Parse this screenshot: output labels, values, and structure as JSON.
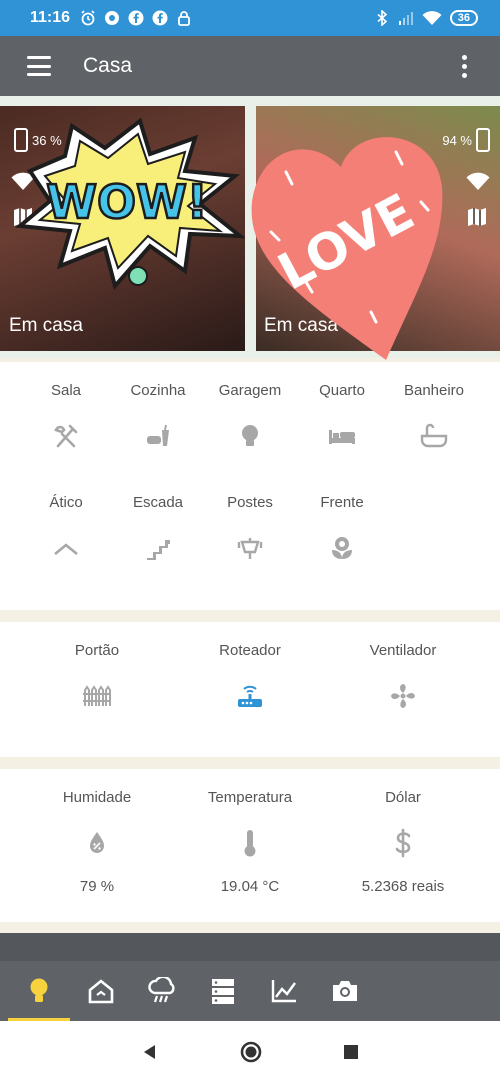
{
  "status_bar": {
    "time": "11:16",
    "battery": "36"
  },
  "app_bar": {
    "title": "Casa"
  },
  "cameras": [
    {
      "battery": "36 %",
      "status": "Em casa"
    },
    {
      "battery": "94 %",
      "status": "Em casa"
    }
  ],
  "stickers": {
    "wow": "WOW!",
    "love": "LOVE"
  },
  "rooms": [
    {
      "label": "Sala",
      "icon": "utensils-icon"
    },
    {
      "label": "Cozinha",
      "icon": "fastfood-icon"
    },
    {
      "label": "Garagem",
      "icon": "lightbulb-icon"
    },
    {
      "label": "Quarto",
      "icon": "bed-icon"
    },
    {
      "label": "Banheiro",
      "icon": "bathtub-icon"
    },
    {
      "label": "Ático",
      "icon": "roof-icon"
    },
    {
      "label": "Escada",
      "icon": "stairs-icon"
    },
    {
      "label": "Postes",
      "icon": "lamp-post-icon"
    },
    {
      "label": "Frente",
      "icon": "flower-icon"
    }
  ],
  "devices": [
    {
      "label": "Portão",
      "icon": "fence-icon"
    },
    {
      "label": "Roteador",
      "icon": "router-icon",
      "color": "#2f93d6"
    },
    {
      "label": "Ventilador",
      "icon": "fan-icon"
    }
  ],
  "sensors": [
    {
      "label": "Humidade",
      "icon": "water-drop-icon",
      "value": "79 %"
    },
    {
      "label": "Temperatura",
      "icon": "thermometer-icon",
      "value": "19.04 °C"
    },
    {
      "label": "Dólar",
      "icon": "dollar-icon",
      "value": "5.2368 reais"
    }
  ],
  "bottom_nav": [
    "lightbulb-icon",
    "home-icon",
    "weather-icon",
    "server-icon",
    "chart-icon",
    "camera-icon"
  ],
  "colors": {
    "status_bar": "#2f93d6",
    "app_bar": "#5f6368",
    "active_accent": "#f7d23e",
    "icon_grey": "#a7a7a7"
  }
}
